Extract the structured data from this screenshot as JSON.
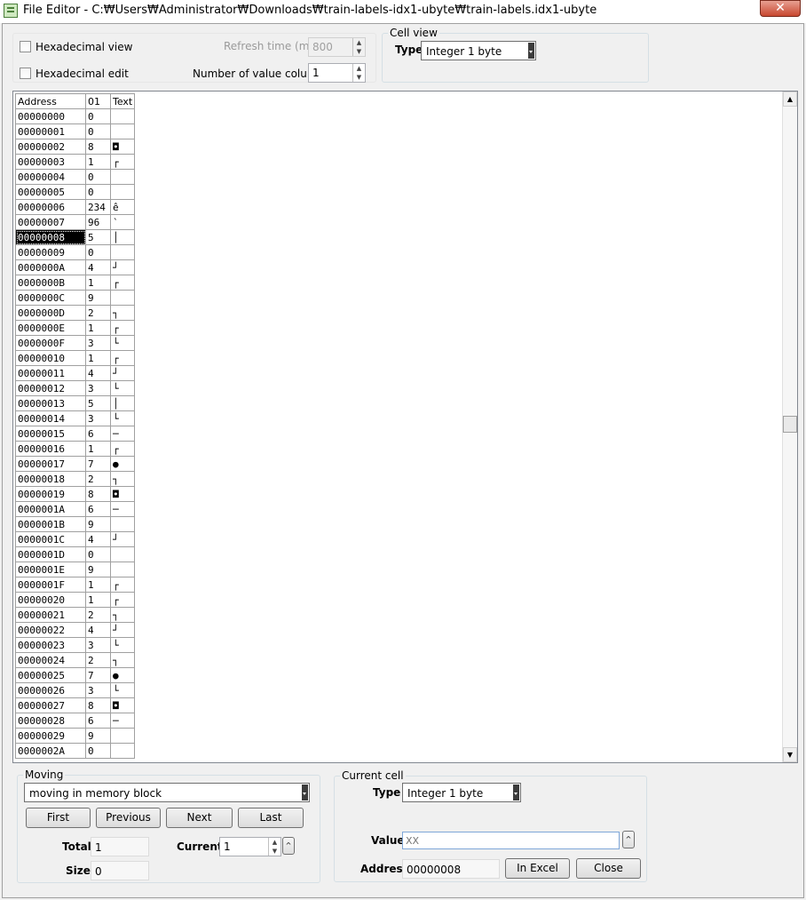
{
  "window": {
    "title": "File Editor - C:₩Users₩Administrator₩Downloads₩train-labels-idx1-ubyte₩train-labels.idx1-ubyte",
    "close_glyph": "✕"
  },
  "options": {
    "hex_view_label": "Hexadecimal view",
    "hex_edit_label": "Hexadecimal edit",
    "refresh_label": "Refresh time (ms)",
    "refresh_value": "800",
    "columns_label": "Number of value columns",
    "columns_value": "1"
  },
  "cell_view": {
    "title": "Cell view",
    "type_label": "Type",
    "type_value": "Integer 1 byte"
  },
  "grid": {
    "headers": [
      "Address",
      "01",
      "Text"
    ],
    "selected_address": "00000008",
    "rows": [
      [
        "00000000",
        "0",
        ""
      ],
      [
        "00000001",
        "0",
        ""
      ],
      [
        "00000002",
        "8",
        "◘"
      ],
      [
        "00000003",
        "1",
        "┌"
      ],
      [
        "00000004",
        "0",
        ""
      ],
      [
        "00000005",
        "0",
        ""
      ],
      [
        "00000006",
        "234",
        "ê"
      ],
      [
        "00000007",
        "96",
        "`"
      ],
      [
        "00000008",
        "5",
        "│"
      ],
      [
        "00000009",
        "0",
        ""
      ],
      [
        "0000000A",
        "4",
        "┘"
      ],
      [
        "0000000B",
        "1",
        "┌"
      ],
      [
        "0000000C",
        "9",
        ""
      ],
      [
        "0000000D",
        "2",
        "┐"
      ],
      [
        "0000000E",
        "1",
        "┌"
      ],
      [
        "0000000F",
        "3",
        "└"
      ],
      [
        "00000010",
        "1",
        "┌"
      ],
      [
        "00000011",
        "4",
        "┘"
      ],
      [
        "00000012",
        "3",
        "└"
      ],
      [
        "00000013",
        "5",
        "│"
      ],
      [
        "00000014",
        "3",
        "└"
      ],
      [
        "00000015",
        "6",
        "─"
      ],
      [
        "00000016",
        "1",
        "┌"
      ],
      [
        "00000017",
        "7",
        "●"
      ],
      [
        "00000018",
        "2",
        "┐"
      ],
      [
        "00000019",
        "8",
        "◘"
      ],
      [
        "0000001A",
        "6",
        "─"
      ],
      [
        "0000001B",
        "9",
        ""
      ],
      [
        "0000001C",
        "4",
        "┘"
      ],
      [
        "0000001D",
        "0",
        ""
      ],
      [
        "0000001E",
        "9",
        ""
      ],
      [
        "0000001F",
        "1",
        "┌"
      ],
      [
        "00000020",
        "1",
        "┌"
      ],
      [
        "00000021",
        "2",
        "┐"
      ],
      [
        "00000022",
        "4",
        "┘"
      ],
      [
        "00000023",
        "3",
        "└"
      ],
      [
        "00000024",
        "2",
        "┐"
      ],
      [
        "00000025",
        "7",
        "●"
      ],
      [
        "00000026",
        "3",
        "└"
      ],
      [
        "00000027",
        "8",
        "◘"
      ],
      [
        "00000028",
        "6",
        "─"
      ],
      [
        "00000029",
        "9",
        ""
      ],
      [
        "0000002A",
        "0",
        ""
      ]
    ]
  },
  "moving": {
    "title": "Moving",
    "mode_value": "moving in memory block",
    "first_label": "First",
    "previous_label": "Previous",
    "next_label": "Next",
    "last_label": "Last",
    "total_label": "Total",
    "total_value": "1",
    "current_label": "Current",
    "current_value": "1",
    "size_label": "Size",
    "size_value": "0"
  },
  "current_cell": {
    "title": "Current cell",
    "type_label": "Type",
    "type_value": "Integer 1 byte",
    "value_label": "Value",
    "value_placeholder": "XX",
    "address_label": "Address",
    "address_value": "00000008",
    "in_excel_label": "In Excel",
    "close_label": "Close"
  },
  "icons": {
    "spin_up": "▲",
    "spin_down": "▼",
    "expand": "^"
  }
}
